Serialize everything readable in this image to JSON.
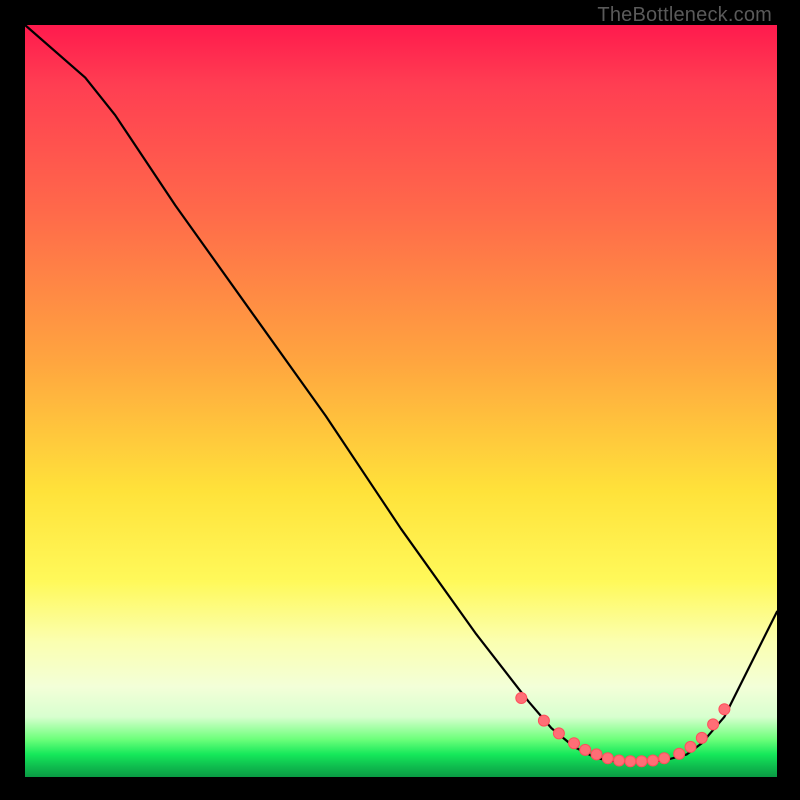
{
  "watermark": "TheBottleneck.com",
  "colors": {
    "line": "#000000",
    "dot_fill": "#ff6e76",
    "dot_stroke": "#ff4f5c",
    "background_black": "#000000"
  },
  "chart_data": {
    "type": "line",
    "title": "",
    "xlabel": "",
    "ylabel": "",
    "xlim": [
      0,
      100
    ],
    "ylim": [
      0,
      100
    ],
    "series": [
      {
        "name": "curve",
        "x": [
          0,
          8,
          12,
          20,
          30,
          40,
          50,
          60,
          67,
          70,
          73,
          76,
          79,
          82,
          85,
          88,
          90,
          93,
          96,
          100
        ],
        "y": [
          100,
          93,
          88,
          76,
          62,
          48,
          33,
          19,
          10,
          6.5,
          4,
          2.5,
          2,
          2,
          2.2,
          3,
          4.5,
          8,
          14,
          22
        ]
      }
    ],
    "markers": {
      "name": "optimal-range-dots",
      "x": [
        66,
        69,
        71,
        73,
        74.5,
        76,
        77.5,
        79,
        80.5,
        82,
        83.5,
        85,
        87,
        88.5,
        90,
        91.5,
        93
      ],
      "y": [
        10.5,
        7.5,
        5.8,
        4.5,
        3.6,
        3.0,
        2.5,
        2.2,
        2.1,
        2.1,
        2.2,
        2.5,
        3.1,
        4.0,
        5.2,
        7.0,
        9.0
      ]
    }
  }
}
